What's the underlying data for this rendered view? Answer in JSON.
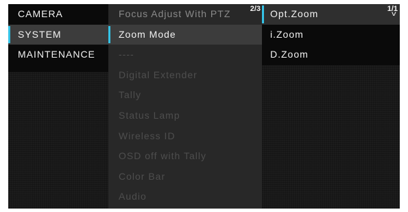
{
  "categories": [
    {
      "label": "CAMERA"
    },
    {
      "label": "SYSTEM"
    },
    {
      "label": "MAINTENANCE"
    }
  ],
  "submenu": {
    "page": "2/3",
    "items": [
      {
        "label": "Focus Adjust With PTZ",
        "state": "active"
      },
      {
        "label": "Zoom Mode",
        "state": "selected"
      },
      {
        "label": "----",
        "state": "dim"
      },
      {
        "label": "Digital Extender",
        "state": "dim"
      },
      {
        "label": "Tally",
        "state": "dim"
      },
      {
        "label": "Status Lamp",
        "state": "dim"
      },
      {
        "label": "Wireless ID",
        "state": "dim"
      },
      {
        "label": "OSD off with Tally",
        "state": "dim"
      },
      {
        "label": "Color Bar",
        "state": "dim"
      },
      {
        "label": "Audio",
        "state": "dim"
      }
    ]
  },
  "options": {
    "page": "1/1",
    "scroll_indicator": "v",
    "items": [
      {
        "label": "Opt.Zoom",
        "state": "selected"
      },
      {
        "label": "i.Zoom",
        "state": "normal"
      },
      {
        "label": "D.Zoom",
        "state": "normal"
      }
    ]
  },
  "colors": {
    "accent": "#35c3e6",
    "panel": "#282828",
    "background": "#161616",
    "text": "#f2f2f2"
  }
}
